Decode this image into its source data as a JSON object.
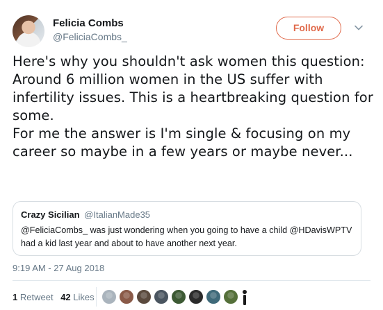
{
  "author": {
    "name": "Felicia Combs",
    "handle": "@FeliciaCombs_",
    "avatar_icon": "profile-photo"
  },
  "follow_button": {
    "label": "Follow",
    "color": "#e0694a"
  },
  "menu_icon": "chevron-down-icon",
  "tweet_text": "Here's why you shouldn't ask women this question: Around 6 million women in the US suffer with infertility issues. This is a heartbreaking question for some.\nFor me the answer is I'm single & focusing on my career so maybe in a few years or maybe never...",
  "quote": {
    "name": "Crazy Sicilian",
    "handle": "@ItalianMade35",
    "text": "@FeliciaCombs_ was just wondering when you going to have a child @HDavisWPTV had a kid last year and about to have another next year."
  },
  "timestamp": "9:19 AM - 27 Aug 2018",
  "stats": {
    "retweets_count": "1",
    "retweets_label": "Retweet",
    "likes_count": "42",
    "likes_label": "Likes"
  },
  "likers": [
    {
      "name": "liker-avatar-1",
      "color": "#aab4bd"
    },
    {
      "name": "liker-avatar-2",
      "color": "#8a5a48"
    },
    {
      "name": "liker-avatar-3",
      "color": "#5b4a3e"
    },
    {
      "name": "liker-avatar-4",
      "color": "#4a5560"
    },
    {
      "name": "liker-avatar-5",
      "color": "#3d5a34"
    },
    {
      "name": "liker-avatar-6",
      "color": "#2b2b2b"
    },
    {
      "name": "liker-avatar-7",
      "color": "#3f6a7a"
    },
    {
      "name": "liker-avatar-8",
      "color": "#55703a"
    },
    {
      "name": "liker-avatar-9",
      "color": "#1a1a1a"
    }
  ]
}
